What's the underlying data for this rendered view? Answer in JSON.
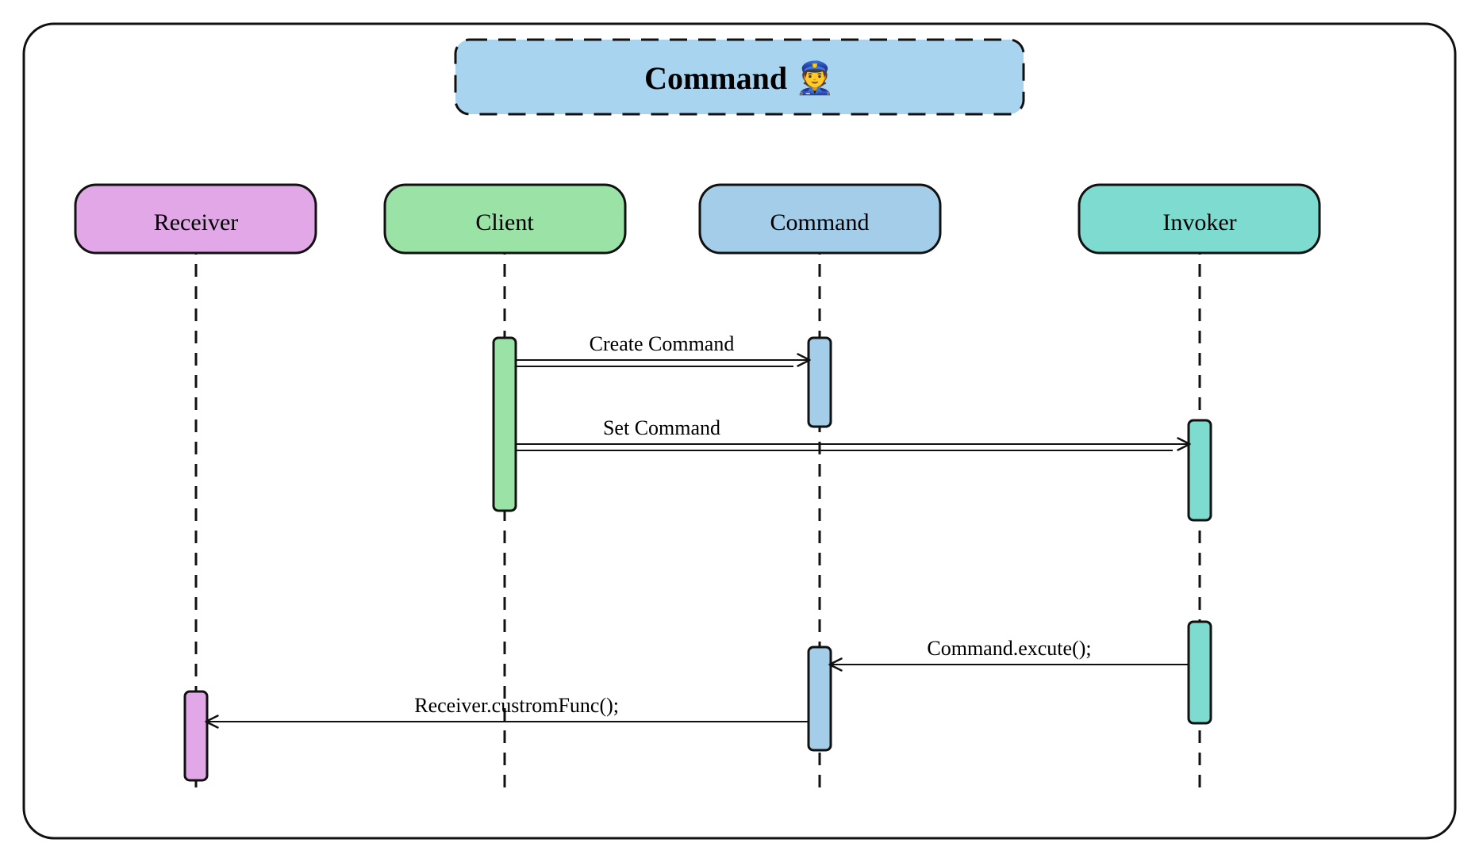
{
  "diagram": {
    "title": "Command 👮",
    "actors": {
      "receiver": "Receiver",
      "client": "Client",
      "command": "Command",
      "invoker": "Invoker"
    },
    "messages": {
      "create_command": "Create Command",
      "set_command": "Set Command",
      "command_execute": "Command.excute();",
      "receiver_custom_func": "Receiver.custromFunc();"
    },
    "colors": {
      "receiver": "#e1a7e6",
      "client": "#9be2a6",
      "command": "#a4cdea",
      "invoker": "#7edbd0",
      "title_bg": "#a9d4ef",
      "stroke": "#111"
    }
  }
}
